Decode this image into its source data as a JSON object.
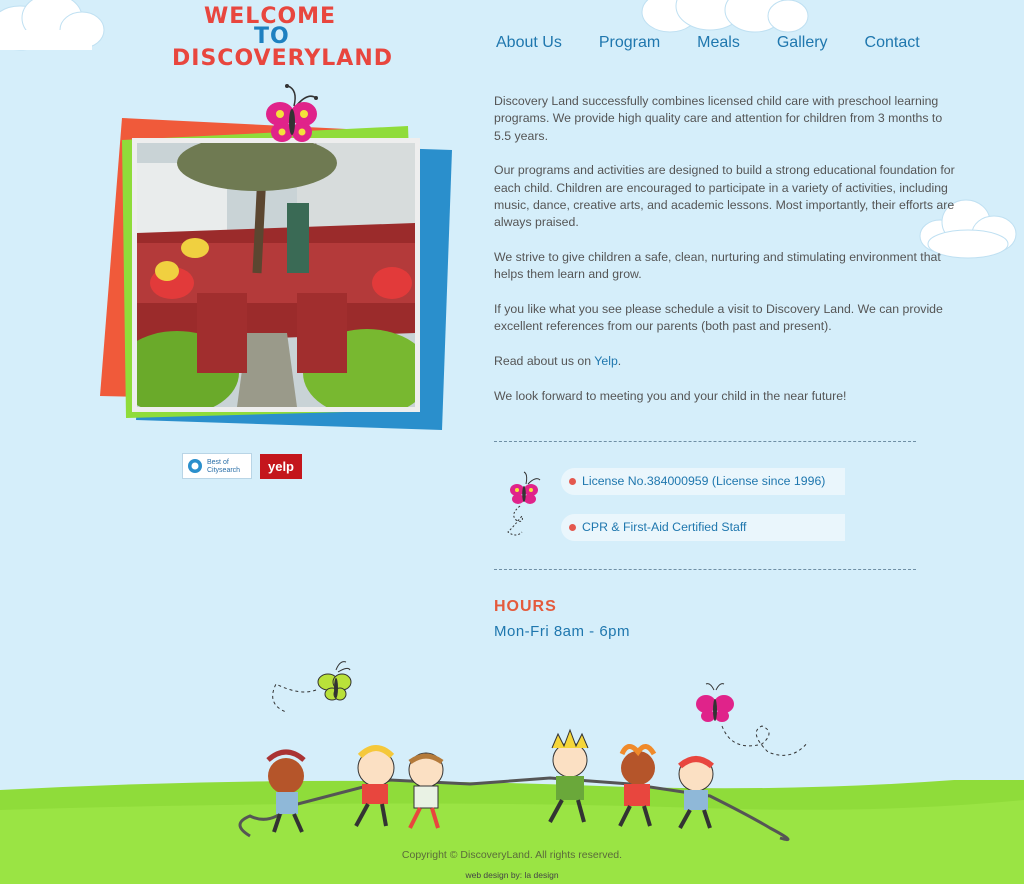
{
  "logo": {
    "line1": "WELCOME",
    "line2": "TO",
    "line3": "DISCOVERYLAND"
  },
  "nav": {
    "items": [
      "About Us",
      "Program",
      "Meals",
      "Gallery",
      "Contact"
    ]
  },
  "badges": {
    "citysearch_line1": "Best of",
    "citysearch_line2": "Citysearch",
    "yelp": "yelp"
  },
  "intro": {
    "p1": "Discovery Land successfully combines licensed child care with preschool learning programs. We provide high quality care and attention for children from 3 months to 5.5 years.",
    "p2": "Our programs and activities are designed to build a strong educational foundation for each child. Children are encouraged to participate in a variety of activities, including music, dance, creative arts, and academic lessons. Most importantly, their efforts are always praised.",
    "p3": "We strive to give children a safe, clean, nurturing and stimulating environment that helps them learn and grow.",
    "p4": "If you like what you see please schedule a visit to Discovery Land. We can provide excellent references from our parents (both past and present).",
    "p5_prefix": "Read about us on",
    "p5_link": "Yelp",
    "p5_suffix": ".",
    "p6": "We look forward to meeting you and your child in the near future!"
  },
  "features": {
    "license": "License No.384000959 (License since 1996)",
    "cpr": "CPR & First-Aid Certified Staff"
  },
  "hours": {
    "title": "HOURS",
    "value": "Mon-Fri 8am - 6pm"
  },
  "footer": {
    "copyright": "Copyright © DiscoveryLand. All rights reserved.",
    "design": "web design by:  la design"
  },
  "colors": {
    "background": "#d5eefa",
    "link": "#1f77ae",
    "accent_red": "#e45a3c",
    "grass": "#8fdc3a"
  }
}
